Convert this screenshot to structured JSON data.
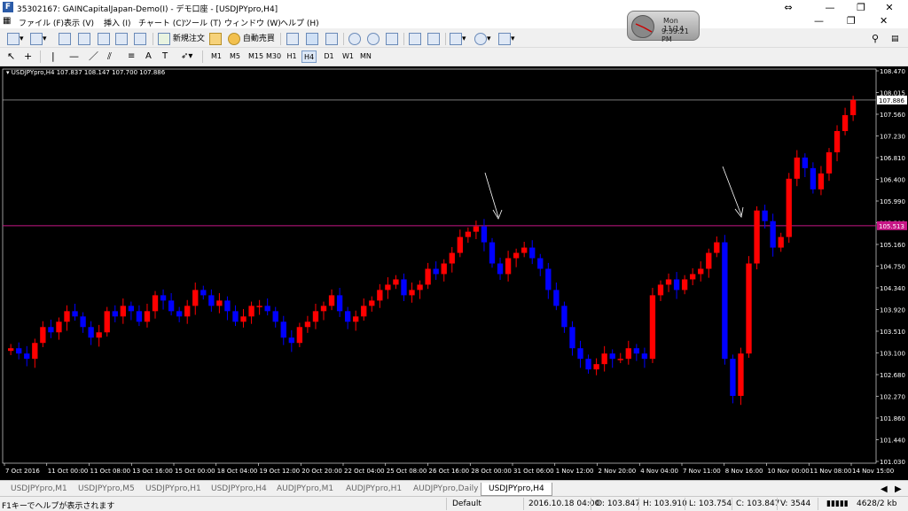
{
  "window": {
    "title": "35302167: GAINCapitalJapan-Demo(I) - デモ口座 - [USDJPYpro,H4]"
  },
  "menu": [
    "ファイル (F)",
    "表示 (V)",
    "挿入 (I)",
    "チャート (C)",
    "ツール (T)",
    "ウィンドウ (W)",
    "ヘルプ (H)"
  ],
  "clock": {
    "day": "Mon 11/14",
    "time": "9:39:21 PM"
  },
  "toolbar": {
    "new_order_label": "新規注文",
    "autotrade_label": "自動売買"
  },
  "timeframes": [
    "M1",
    "M5",
    "M15",
    "M30",
    "H1",
    "H4",
    "D1",
    "W1",
    "MN"
  ],
  "active_timeframe": "H4",
  "chart": {
    "info": "USDJPYpro,H4  107.837 108.147 107.700 107.886",
    "bid_label": "107.886",
    "level_label": "105.513",
    "colors": {
      "background": "#000000",
      "bull": "#ff0000",
      "bear": "#0000ff",
      "bid_line": "#c0c0c0",
      "level_line": "#c71585"
    }
  },
  "chart_data": {
    "type": "candlestick",
    "title": "USDJPYpro,H4",
    "y_ticks": [
      "108.470",
      "108.015",
      "107.560",
      "107.230",
      "106.810",
      "106.400",
      "105.990",
      "105.580",
      "105.160",
      "104.750",
      "104.340",
      "103.920",
      "103.510",
      "103.100",
      "102.680",
      "102.270",
      "101.860",
      "101.440",
      "101.030"
    ],
    "x_ticks": [
      "7 Oct 2016",
      "11 Oct 00:00",
      "11 Oct 08:00",
      "13 Oct 16:00",
      "15 Oct 00:00",
      "18 Oct 04:00",
      "19 Oct 12:00",
      "20 Oct 20:00",
      "22 Oct 04:00",
      "25 Oct 08:00",
      "26 Oct 16:00",
      "28 Oct 00:00",
      "31 Oct 06:00",
      "1 Nov 12:00",
      "2 Nov 20:00",
      "4 Nov 04:00",
      "7 Nov 11:00",
      "8 Nov 16:00",
      "10 Nov 00:00",
      "11 Nov 08:00",
      "14 Nov 15:00"
    ],
    "ylim": [
      101.03,
      108.47
    ],
    "horizontal_lines": [
      105.513,
      107.886
    ],
    "closes": [
      103.2,
      103.1,
      103.0,
      103.3,
      103.6,
      103.5,
      103.7,
      103.9,
      103.8,
      103.6,
      103.4,
      103.5,
      103.9,
      103.8,
      104.0,
      103.9,
      103.7,
      103.9,
      104.2,
      104.1,
      103.9,
      103.8,
      104.0,
      104.3,
      104.2,
      104.0,
      104.1,
      103.9,
      103.7,
      103.8,
      104.0,
      104.0,
      103.9,
      103.7,
      103.4,
      103.3,
      103.6,
      103.7,
      103.9,
      104.0,
      104.2,
      103.9,
      103.7,
      103.8,
      104.0,
      104.1,
      104.3,
      104.4,
      104.5,
      104.2,
      104.3,
      104.4,
      104.7,
      104.6,
      104.8,
      105.0,
      105.3,
      105.4,
      105.5,
      105.2,
      104.8,
      104.6,
      104.9,
      105.0,
      105.1,
      104.9,
      104.7,
      104.3,
      104.0,
      103.6,
      103.2,
      103.0,
      102.8,
      102.9,
      103.1,
      103.0,
      103.0,
      103.2,
      103.1,
      103.0,
      104.2,
      104.4,
      104.5,
      104.3,
      104.5,
      104.6,
      104.7,
      105.0,
      105.2,
      103.0,
      102.3,
      103.1,
      104.8,
      105.8,
      105.6,
      105.1,
      105.3,
      106.4,
      106.8,
      106.6,
      106.2,
      106.5,
      106.9,
      107.3,
      107.6,
      107.886
    ]
  },
  "tabs": [
    "USDJPYpro,M1",
    "USDJPYpro,M5",
    "USDJPYpro,H1",
    "USDJPYpro,H4",
    "AUDJPYpro,M1",
    "AUDJPYpro,H1",
    "AUDJPYpro,Daily",
    "USDJPYpro,H4"
  ],
  "active_tab_index": 7,
  "status": {
    "help": "F1キーでヘルプが表示されます",
    "profile": "Default",
    "datetime": "2016.10.18 04:00",
    "open": "O: 103.847",
    "high": "H: 103.910",
    "low": "L: 103.754",
    "close": "C: 103.847",
    "volume": "V: 3544",
    "traffic": "4628/2 kb"
  }
}
